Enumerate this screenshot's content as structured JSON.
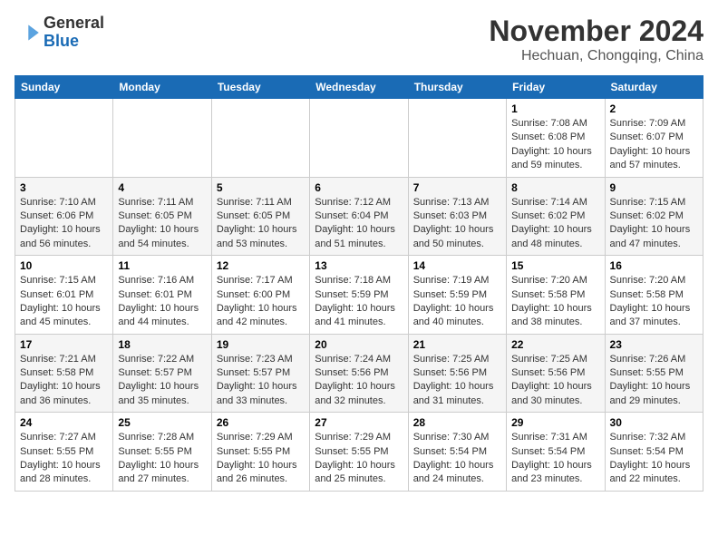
{
  "header": {
    "logo_line1": "General",
    "logo_line2": "Blue",
    "month_year": "November 2024",
    "location": "Hechuan, Chongqing, China"
  },
  "days_of_week": [
    "Sunday",
    "Monday",
    "Tuesday",
    "Wednesday",
    "Thursday",
    "Friday",
    "Saturday"
  ],
  "weeks": [
    [
      {
        "day": "",
        "info": ""
      },
      {
        "day": "",
        "info": ""
      },
      {
        "day": "",
        "info": ""
      },
      {
        "day": "",
        "info": ""
      },
      {
        "day": "",
        "info": ""
      },
      {
        "day": "1",
        "info": "Sunrise: 7:08 AM\nSunset: 6:08 PM\nDaylight: 10 hours and 59 minutes."
      },
      {
        "day": "2",
        "info": "Sunrise: 7:09 AM\nSunset: 6:07 PM\nDaylight: 10 hours and 57 minutes."
      }
    ],
    [
      {
        "day": "3",
        "info": "Sunrise: 7:10 AM\nSunset: 6:06 PM\nDaylight: 10 hours and 56 minutes."
      },
      {
        "day": "4",
        "info": "Sunrise: 7:11 AM\nSunset: 6:05 PM\nDaylight: 10 hours and 54 minutes."
      },
      {
        "day": "5",
        "info": "Sunrise: 7:11 AM\nSunset: 6:05 PM\nDaylight: 10 hours and 53 minutes."
      },
      {
        "day": "6",
        "info": "Sunrise: 7:12 AM\nSunset: 6:04 PM\nDaylight: 10 hours and 51 minutes."
      },
      {
        "day": "7",
        "info": "Sunrise: 7:13 AM\nSunset: 6:03 PM\nDaylight: 10 hours and 50 minutes."
      },
      {
        "day": "8",
        "info": "Sunrise: 7:14 AM\nSunset: 6:02 PM\nDaylight: 10 hours and 48 minutes."
      },
      {
        "day": "9",
        "info": "Sunrise: 7:15 AM\nSunset: 6:02 PM\nDaylight: 10 hours and 47 minutes."
      }
    ],
    [
      {
        "day": "10",
        "info": "Sunrise: 7:15 AM\nSunset: 6:01 PM\nDaylight: 10 hours and 45 minutes."
      },
      {
        "day": "11",
        "info": "Sunrise: 7:16 AM\nSunset: 6:01 PM\nDaylight: 10 hours and 44 minutes."
      },
      {
        "day": "12",
        "info": "Sunrise: 7:17 AM\nSunset: 6:00 PM\nDaylight: 10 hours and 42 minutes."
      },
      {
        "day": "13",
        "info": "Sunrise: 7:18 AM\nSunset: 5:59 PM\nDaylight: 10 hours and 41 minutes."
      },
      {
        "day": "14",
        "info": "Sunrise: 7:19 AM\nSunset: 5:59 PM\nDaylight: 10 hours and 40 minutes."
      },
      {
        "day": "15",
        "info": "Sunrise: 7:20 AM\nSunset: 5:58 PM\nDaylight: 10 hours and 38 minutes."
      },
      {
        "day": "16",
        "info": "Sunrise: 7:20 AM\nSunset: 5:58 PM\nDaylight: 10 hours and 37 minutes."
      }
    ],
    [
      {
        "day": "17",
        "info": "Sunrise: 7:21 AM\nSunset: 5:58 PM\nDaylight: 10 hours and 36 minutes."
      },
      {
        "day": "18",
        "info": "Sunrise: 7:22 AM\nSunset: 5:57 PM\nDaylight: 10 hours and 35 minutes."
      },
      {
        "day": "19",
        "info": "Sunrise: 7:23 AM\nSunset: 5:57 PM\nDaylight: 10 hours and 33 minutes."
      },
      {
        "day": "20",
        "info": "Sunrise: 7:24 AM\nSunset: 5:56 PM\nDaylight: 10 hours and 32 minutes."
      },
      {
        "day": "21",
        "info": "Sunrise: 7:25 AM\nSunset: 5:56 PM\nDaylight: 10 hours and 31 minutes."
      },
      {
        "day": "22",
        "info": "Sunrise: 7:25 AM\nSunset: 5:56 PM\nDaylight: 10 hours and 30 minutes."
      },
      {
        "day": "23",
        "info": "Sunrise: 7:26 AM\nSunset: 5:55 PM\nDaylight: 10 hours and 29 minutes."
      }
    ],
    [
      {
        "day": "24",
        "info": "Sunrise: 7:27 AM\nSunset: 5:55 PM\nDaylight: 10 hours and 28 minutes."
      },
      {
        "day": "25",
        "info": "Sunrise: 7:28 AM\nSunset: 5:55 PM\nDaylight: 10 hours and 27 minutes."
      },
      {
        "day": "26",
        "info": "Sunrise: 7:29 AM\nSunset: 5:55 PM\nDaylight: 10 hours and 26 minutes."
      },
      {
        "day": "27",
        "info": "Sunrise: 7:29 AM\nSunset: 5:55 PM\nDaylight: 10 hours and 25 minutes."
      },
      {
        "day": "28",
        "info": "Sunrise: 7:30 AM\nSunset: 5:54 PM\nDaylight: 10 hours and 24 minutes."
      },
      {
        "day": "29",
        "info": "Sunrise: 7:31 AM\nSunset: 5:54 PM\nDaylight: 10 hours and 23 minutes."
      },
      {
        "day": "30",
        "info": "Sunrise: 7:32 AM\nSunset: 5:54 PM\nDaylight: 10 hours and 22 minutes."
      }
    ]
  ]
}
